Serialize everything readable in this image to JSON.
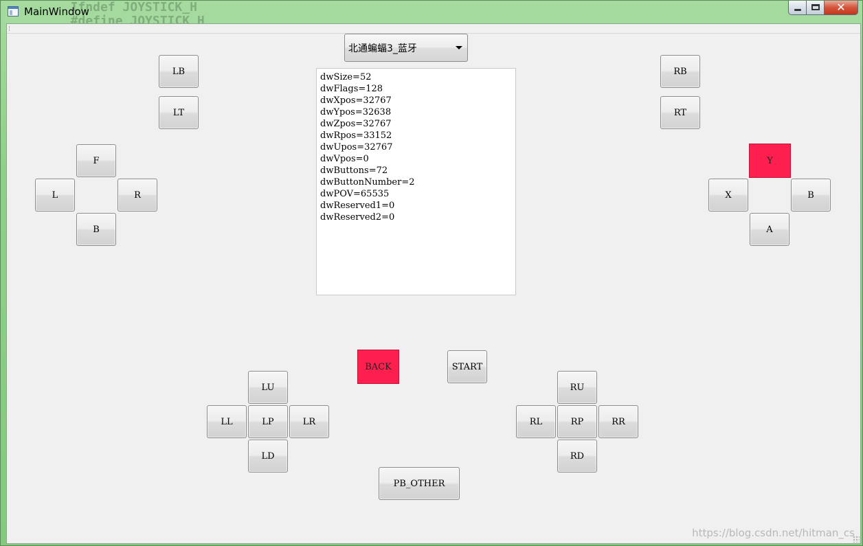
{
  "window": {
    "title": "MainWindow",
    "background_code_lines": [
      "  Ifndef JOYSTICK_H",
      "  #define JOYSTICK_H"
    ],
    "close_symbol": "✕"
  },
  "combo": {
    "selected": "北通蝙蝠3_蓝牙"
  },
  "info_lines": [
    "dwSize=52",
    "dwFlags=128",
    "dwXpos=32767",
    "dwYpos=32638",
    "dwZpos=32767",
    "dwRpos=33152",
    "dwUpos=32767",
    "dwVpos=0",
    "dwButtons=72",
    "dwButtonNumber=2",
    "dwPOV=65535",
    "dwReserved1=0",
    "dwReserved2=0"
  ],
  "buttons": {
    "lb": "LB",
    "lt": "LT",
    "rb": "RB",
    "rt": "RT",
    "dpad_f": "F",
    "dpad_l": "L",
    "dpad_r": "R",
    "dpad_b": "B",
    "face_y": "Y",
    "face_x": "X",
    "face_b": "B",
    "face_a": "A",
    "back": "BACK",
    "start": "START",
    "lu": "LU",
    "ll": "LL",
    "lp": "LP",
    "lr": "LR",
    "ld": "LD",
    "ru": "RU",
    "rl": "RL",
    "rp": "RP",
    "rr": "RR",
    "rd": "RD",
    "pb_other": "PB_OTHER"
  },
  "pressed_color": "#ff1f4f",
  "watermark": "https://blog.csdn.net/hitman_cs"
}
